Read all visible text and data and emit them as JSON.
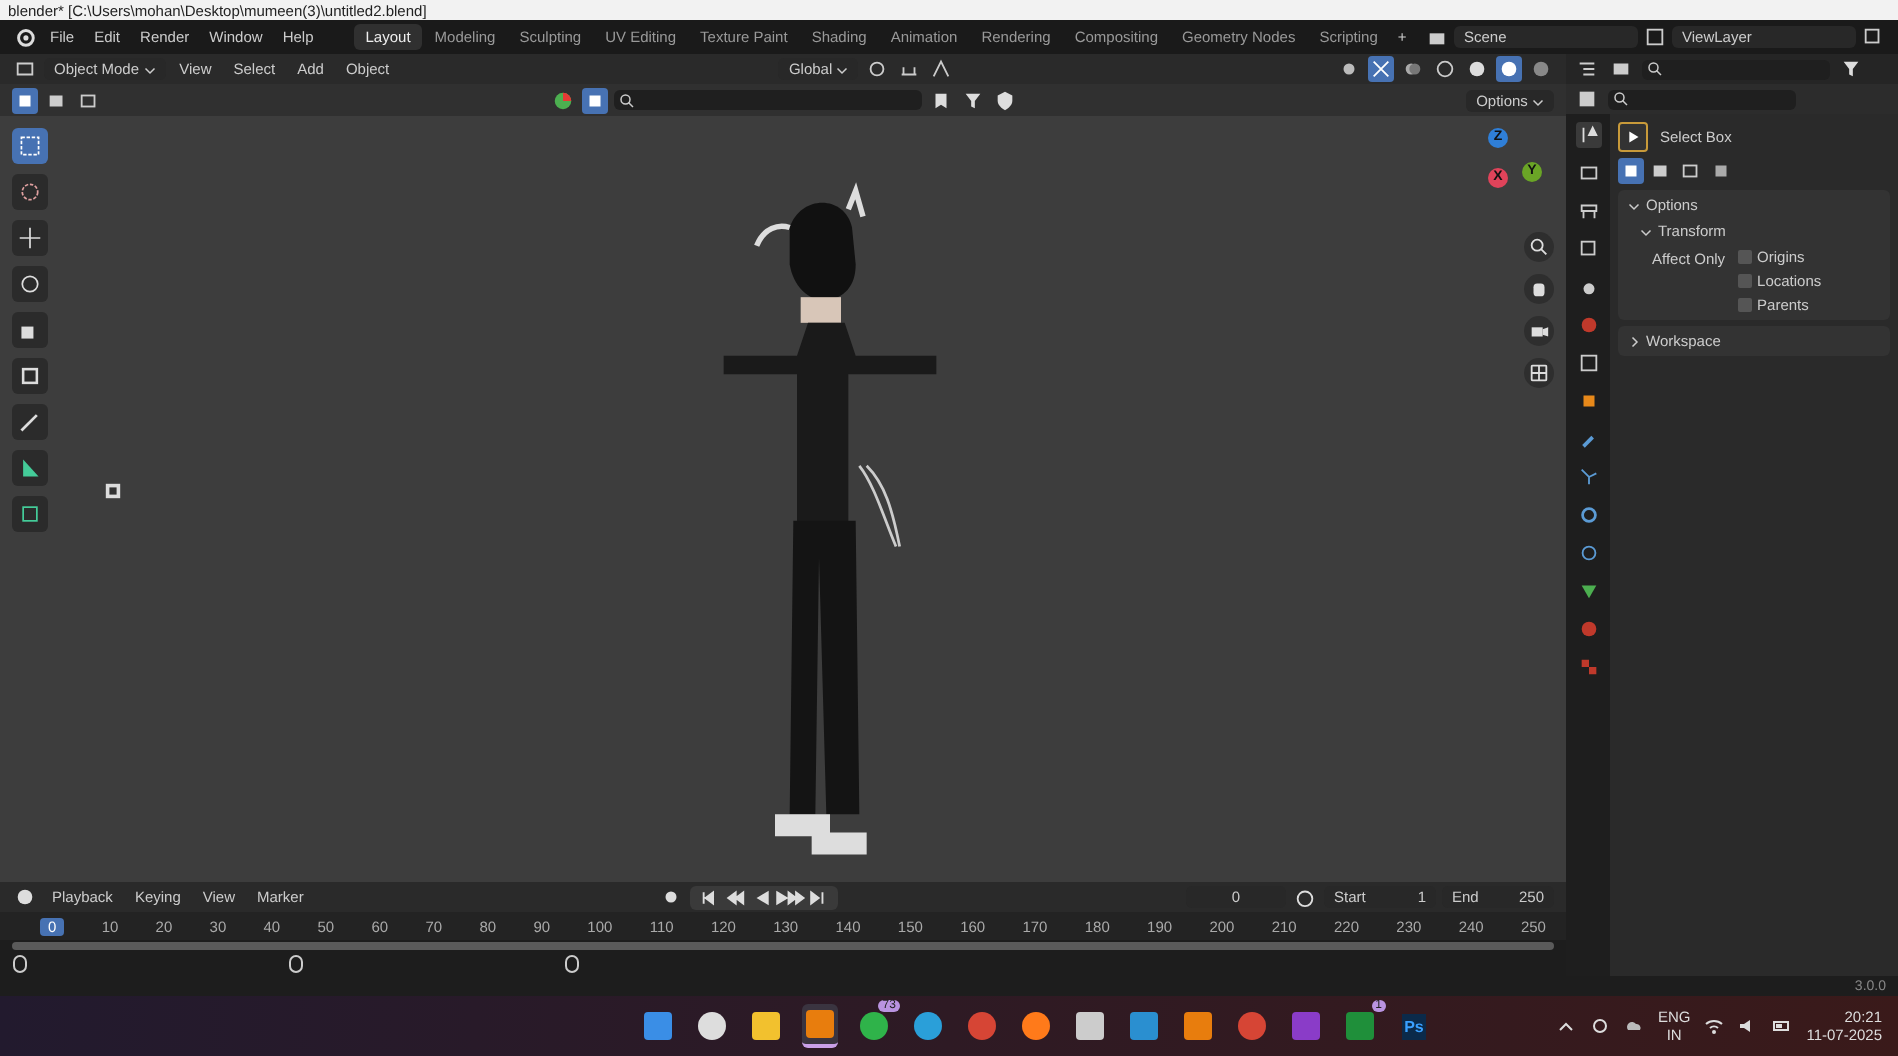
{
  "title_bar": {
    "title": "blender* [C:\\Users\\mohan\\Desktop\\mumeen(3)\\untitled2.blend]"
  },
  "menu": [
    "File",
    "Edit",
    "Render",
    "Window",
    "Help"
  ],
  "workspaces": [
    {
      "label": "Layout",
      "selected": true
    },
    {
      "label": "Modeling",
      "selected": false
    },
    {
      "label": "Sculpting",
      "selected": false
    },
    {
      "label": "UV Editing",
      "selected": false
    },
    {
      "label": "Texture Paint",
      "selected": false
    },
    {
      "label": "Shading",
      "selected": false
    },
    {
      "label": "Animation",
      "selected": false
    },
    {
      "label": "Rendering",
      "selected": false
    },
    {
      "label": "Compositing",
      "selected": false
    },
    {
      "label": "Geometry Nodes",
      "selected": false
    },
    {
      "label": "Scripting",
      "selected": false
    }
  ],
  "add_workspace": "+",
  "scene": "Scene",
  "view_layer": "ViewLayer",
  "viewport_header": {
    "mode": "Object Mode",
    "menus": [
      "View",
      "Select",
      "Add",
      "Object"
    ],
    "orientation": "Global",
    "options": "Options"
  },
  "tools": [
    {
      "kind": "select",
      "selected": true
    },
    {
      "kind": "cursor",
      "selected": false
    },
    {
      "kind": "move",
      "selected": false
    },
    {
      "kind": "rotate",
      "selected": false
    },
    {
      "kind": "scale",
      "selected": false
    },
    {
      "kind": "transform",
      "selected": false
    },
    {
      "kind": "annotate",
      "selected": false
    },
    {
      "kind": "measure",
      "selected": false
    },
    {
      "kind": "add",
      "selected": false
    }
  ],
  "gizmo": {
    "z": "Z",
    "x": "X",
    "y": "Y"
  },
  "properties": {
    "tool_name": "Select Box",
    "options": "Options",
    "transform": "Transform",
    "affect_only": "Affect Only",
    "checks": [
      {
        "label": "Origins",
        "checked": false
      },
      {
        "label": "Locations",
        "checked": false
      },
      {
        "label": "Parents",
        "checked": false
      }
    ],
    "workspace": "Workspace"
  },
  "timeline": {
    "menus": [
      "Playback",
      "Keying",
      "View",
      "Marker"
    ],
    "current_frame": "0",
    "start_label": "Start",
    "start": "1",
    "end_label": "End",
    "end": "250",
    "playhead": "0",
    "ticks": [
      "10",
      "20",
      "30",
      "40",
      "50",
      "60",
      "70",
      "80",
      "90",
      "100",
      "110",
      "120",
      "130",
      "140",
      "150",
      "160",
      "170",
      "180",
      "190",
      "200",
      "210",
      "220",
      "230",
      "240",
      "250"
    ]
  },
  "version": "3.0.0",
  "taskbar": {
    "apps": [
      {
        "kind": "start",
        "active": false
      },
      {
        "kind": "search",
        "active": false
      },
      {
        "kind": "files",
        "active": false
      },
      {
        "kind": "blender",
        "active": true
      },
      {
        "kind": "whatsapp",
        "active": false,
        "badge": "73"
      },
      {
        "kind": "telegram",
        "active": false
      },
      {
        "kind": "chrome",
        "active": false
      },
      {
        "kind": "firefox",
        "active": false
      },
      {
        "kind": "recorder",
        "active": false
      },
      {
        "kind": "captions",
        "active": false
      },
      {
        "kind": "blender",
        "active": false
      },
      {
        "kind": "chrome",
        "active": false
      },
      {
        "kind": "editor",
        "active": false
      },
      {
        "kind": "xbox",
        "active": false,
        "badge": "1"
      },
      {
        "kind": "photoshop",
        "active": false,
        "label": "Ps"
      }
    ],
    "language": "ENG",
    "region": "IN",
    "time": "20:21",
    "date": "11-07-2025"
  }
}
